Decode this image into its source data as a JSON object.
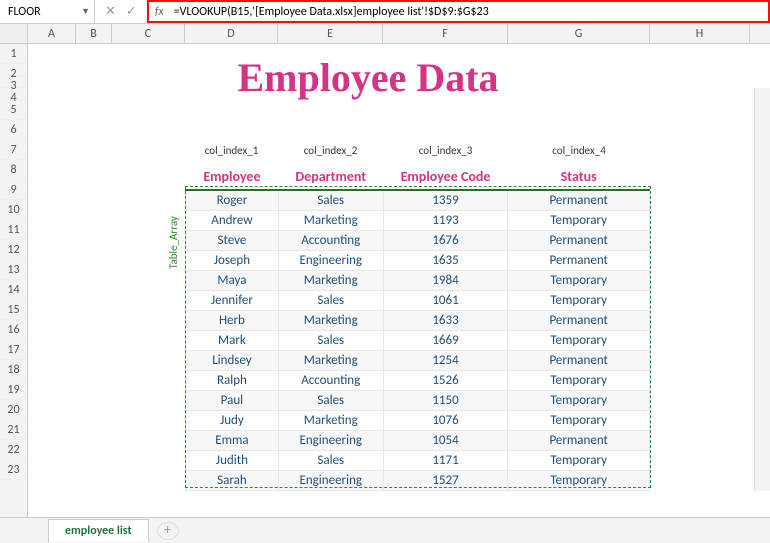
{
  "formula_bar": {
    "name_box": "FLOOR",
    "fx_label": "fx",
    "formula": "=VLOOKUP(B15,'[Employee Data.xlsx]employee list'!$D$9:$G$23"
  },
  "columns": [
    "A",
    "B",
    "C",
    "D",
    "E",
    "F",
    "G",
    "H"
  ],
  "row_numbers": [
    1,
    2,
    3,
    4,
    5,
    6,
    7,
    8,
    9,
    10,
    11,
    12,
    13,
    14,
    15,
    16,
    17,
    18,
    19,
    20,
    21,
    22,
    23
  ],
  "title": "Employee Data",
  "col_index_labels": [
    "col_index_1",
    "col_index_2",
    "col_index_3",
    "col_index_4"
  ],
  "table_array_label": "Table_Array",
  "headers": {
    "c1": "Employee",
    "c2": "Department",
    "c3": "Employee Code",
    "c4": "Status"
  },
  "rows": [
    {
      "emp": "Roger",
      "dept": "Sales",
      "code": "1359",
      "status": "Permanent"
    },
    {
      "emp": "Andrew",
      "dept": "Marketing",
      "code": "1193",
      "status": "Temporary"
    },
    {
      "emp": "Steve",
      "dept": "Accounting",
      "code": "1676",
      "status": "Permanent"
    },
    {
      "emp": "Joseph",
      "dept": "Engineering",
      "code": "1635",
      "status": "Permanent"
    },
    {
      "emp": "Maya",
      "dept": "Marketing",
      "code": "1984",
      "status": "Temporary"
    },
    {
      "emp": "Jennifer",
      "dept": "Sales",
      "code": "1061",
      "status": "Temporary"
    },
    {
      "emp": "Herb",
      "dept": "Marketing",
      "code": "1633",
      "status": "Permanent"
    },
    {
      "emp": "Mark",
      "dept": "Sales",
      "code": "1669",
      "status": "Temporary"
    },
    {
      "emp": "Lindsey",
      "dept": "Marketing",
      "code": "1254",
      "status": "Permanent"
    },
    {
      "emp": "Ralph",
      "dept": "Accounting",
      "code": "1526",
      "status": "Temporary"
    },
    {
      "emp": "Paul",
      "dept": "Sales",
      "code": "1150",
      "status": "Temporary"
    },
    {
      "emp": "Judy",
      "dept": "Marketing",
      "code": "1076",
      "status": "Temporary"
    },
    {
      "emp": "Emma",
      "dept": "Engineering",
      "code": "1054",
      "status": "Permanent"
    },
    {
      "emp": "Judith",
      "dept": "Sales",
      "code": "1171",
      "status": "Temporary"
    },
    {
      "emp": "Sarah",
      "dept": "Engineering",
      "code": "1527",
      "status": "Temporary"
    }
  ],
  "sheet_tabs": {
    "active": "employee list",
    "add_label": "+"
  }
}
